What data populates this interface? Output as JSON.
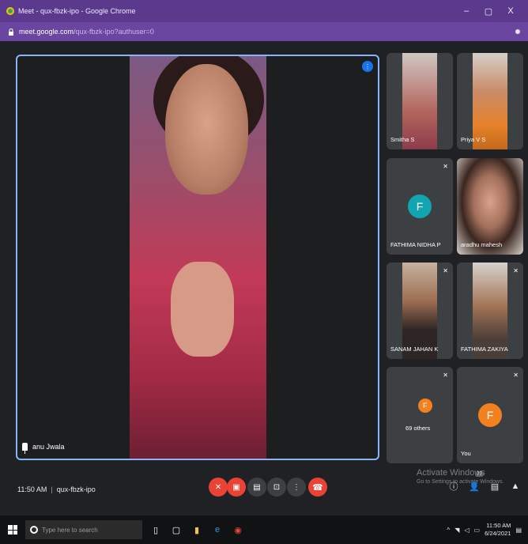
{
  "browser": {
    "tab_title": "Meet - qux-fbzk-ipo - Google Chrome",
    "url_host": "meet.google.com",
    "url_path": "/qux-fbzk-ipo?authuser=0",
    "minimize": "–",
    "maximize": "▢",
    "close": "X"
  },
  "main_tile": {
    "participant_name": "anu Jwala"
  },
  "tiles": [
    {
      "name": "Smitha S",
      "muted": false
    },
    {
      "name": "Priya V S",
      "muted": false
    },
    {
      "name": "FATHIMA NIDHA P",
      "initial": "F",
      "avatar_color": "#12a4af",
      "muted": true
    },
    {
      "name": "aradhu mahesh",
      "muted": false
    },
    {
      "name": "SANAM JAHAN K",
      "muted": true
    },
    {
      "name": "FATHIMA ZAKIYA",
      "muted": true
    },
    {
      "name": "69 others",
      "initial": "F",
      "avatar_color": "#f4811f",
      "muted": true
    },
    {
      "name": "You",
      "initial": "F",
      "avatar_color": "#f4811f",
      "muted": true
    }
  ],
  "meeting": {
    "time": "11:50 AM",
    "code": "qux-fbzk-ipo"
  },
  "watermark": {
    "title": "Activate Windows",
    "subtitle": "Go to Settings to activate Windows."
  },
  "controls": {
    "participants_count": "77"
  },
  "taskbar": {
    "search_placeholder": "Type here to search",
    "clock_time": "11:50 AM",
    "clock_date": "6/24/2021"
  },
  "colors": {
    "chrome_title": "#5b3a8e",
    "chrome_address": "#6a46a0",
    "accent": "#8ab4f8",
    "end_call": "#ea4335",
    "meet_bg": "#202124"
  }
}
